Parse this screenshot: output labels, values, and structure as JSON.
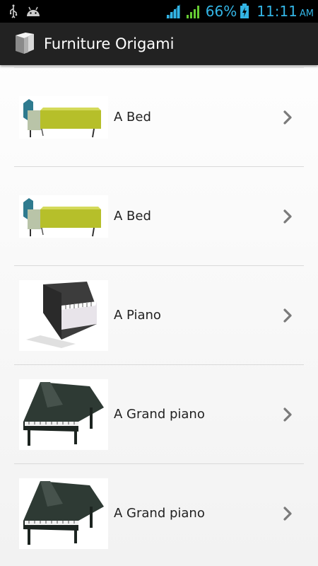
{
  "status_bar": {
    "left_icons": [
      "usb-icon",
      "android-debug-icon"
    ],
    "right_icons": [
      "wifi-signal-icon",
      "cell-signal-icon",
      "battery-charging-icon"
    ],
    "battery_percent": "66%",
    "time": "11:11",
    "ampm": "AM",
    "accent_color": "#33b5e5"
  },
  "action_bar": {
    "title": "Furniture Origami",
    "icon": "origami-app-icon",
    "background": "#222222"
  },
  "list": {
    "items": [
      {
        "label": "A Bed",
        "thumbnail": "bed-thumbnail",
        "icon": "chevron-right-icon"
      },
      {
        "label": "A Bed",
        "thumbnail": "bed-thumbnail",
        "icon": "chevron-right-icon"
      },
      {
        "label": "A Piano",
        "thumbnail": "piano-thumbnail",
        "icon": "chevron-right-icon"
      },
      {
        "label": "A Grand piano",
        "thumbnail": "grand-piano-thumbnail",
        "icon": "chevron-right-icon"
      },
      {
        "label": "A Grand piano",
        "thumbnail": "grand-piano-thumbnail",
        "icon": "chevron-right-icon"
      }
    ]
  }
}
